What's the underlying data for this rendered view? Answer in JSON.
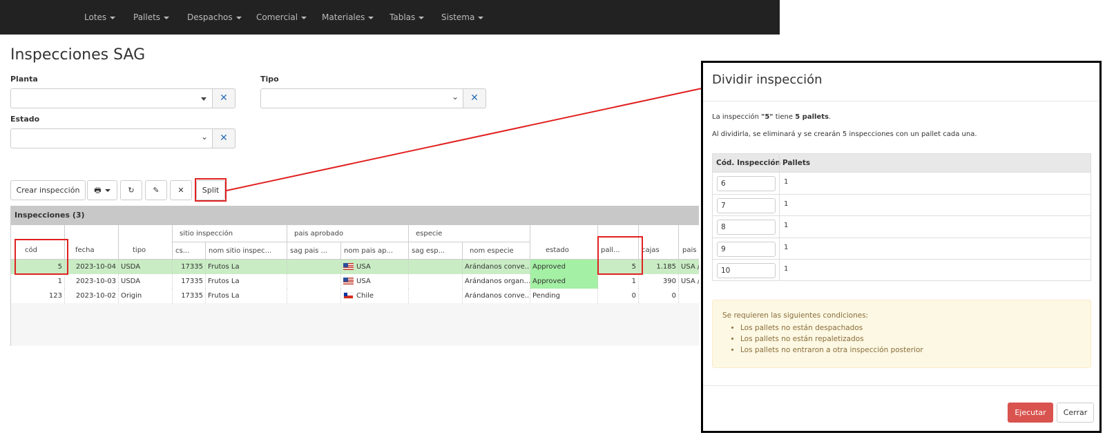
{
  "navbar": {
    "items": [
      {
        "label": "Lotes"
      },
      {
        "label": "Pallets"
      },
      {
        "label": "Despachos"
      },
      {
        "label": "Comercial"
      },
      {
        "label": "Materiales"
      },
      {
        "label": "Tablas"
      },
      {
        "label": "Sistema"
      }
    ]
  },
  "page": {
    "title": "Inspecciones SAG"
  },
  "filters": {
    "planta": {
      "label": "Planta",
      "value": ""
    },
    "tipo": {
      "label": "Tipo",
      "value": ""
    },
    "estado": {
      "label": "Estado",
      "value": ""
    },
    "clear_icon": "times-icon"
  },
  "toolbar": {
    "create_label": "Crear inspección",
    "print_icon": "print-icon",
    "refresh_icon": "refresh-icon",
    "edit_icon": "pencil-icon",
    "delete_icon": "times-icon",
    "split_label": "Split"
  },
  "grid": {
    "title": "Inspecciones (3)",
    "groups": {
      "sitio": "sitio inspección",
      "pais": "pais aprobado",
      "especie": "especie"
    },
    "columns": {
      "cod": "cód",
      "fecha": "fecha",
      "tipo": "tipo",
      "cs": "cs...",
      "nom_sitio": "nom sitio inspec...",
      "sag_pais": "sag pais ...",
      "nom_pais": "nom pais ap...",
      "sag_esp": "sag esp...",
      "nom_especie": "nom especie",
      "estado": "estado",
      "pallets": "pall...",
      "cajas": "cajas",
      "pais": "pais"
    },
    "rows": [
      {
        "cod": "5",
        "fecha": "2023-10-04",
        "tipo": "USDA",
        "cs": "17335",
        "nom_sitio": "Frutos La",
        "sag_pais": "",
        "nom_pais": "USA",
        "flag": "us-flag",
        "sag_esp": "",
        "nom_especie": "Arándanos conve...",
        "estado": "Approved",
        "pallets": "5",
        "cajas": "1.185",
        "pais": "USA /"
      },
      {
        "cod": "1",
        "fecha": "2023-10-03",
        "tipo": "USDA",
        "cs": "17335",
        "nom_sitio": "Frutos La",
        "sag_pais": "",
        "nom_pais": "USA",
        "flag": "us-flag",
        "sag_esp": "",
        "nom_especie": "Arándanos organ...",
        "estado": "Approved",
        "pallets": "1",
        "cajas": "390",
        "pais": "USA /"
      },
      {
        "cod": "123",
        "fecha": "2023-10-02",
        "tipo": "Origin",
        "cs": "17335",
        "nom_sitio": "Frutos La",
        "sag_pais": "",
        "nom_pais": "Chile",
        "flag": "chile-flag",
        "sag_esp": "",
        "nom_especie": "Arándanos conve...",
        "estado": "Pending",
        "pallets": "0",
        "cajas": "0",
        "pais": ""
      }
    ],
    "colors": {
      "selected_row": "#c9ecc4",
      "approved": "#a4f0a4",
      "header_bar": "#c8c8c8"
    }
  },
  "modal": {
    "title": "Dividir inspección",
    "msg1": {
      "a": "La inspección ",
      "b": "\"5\"",
      "c": " tiene ",
      "d": "5 pallets",
      "e": "."
    },
    "msg2": "Al dividirla, se eliminará y se crearán 5 inspecciones con un pallet cada una.",
    "table": {
      "col1": "Cód. Inspección",
      "col2": "Pallets",
      "rows": [
        {
          "codigo": "6",
          "pallets": "1"
        },
        {
          "codigo": "7",
          "pallets": "1"
        },
        {
          "codigo": "8",
          "pallets": "1"
        },
        {
          "codigo": "9",
          "pallets": "1"
        },
        {
          "codigo": "10",
          "pallets": "1"
        }
      ]
    },
    "alert": {
      "heading": "Se requieren las siguientes condiciones:",
      "items": [
        "Los pallets no están despachados",
        "Los pallets no están repaletizados",
        "Los pallets no entraron a otra inspección posterior"
      ],
      "color": "#8a6d3b"
    },
    "execute_label": "Ejecutar",
    "close_label": "Cerrar"
  },
  "colors": {
    "annotation": "#e02020",
    "navbar": "#222222",
    "execute": "#d9534f"
  }
}
